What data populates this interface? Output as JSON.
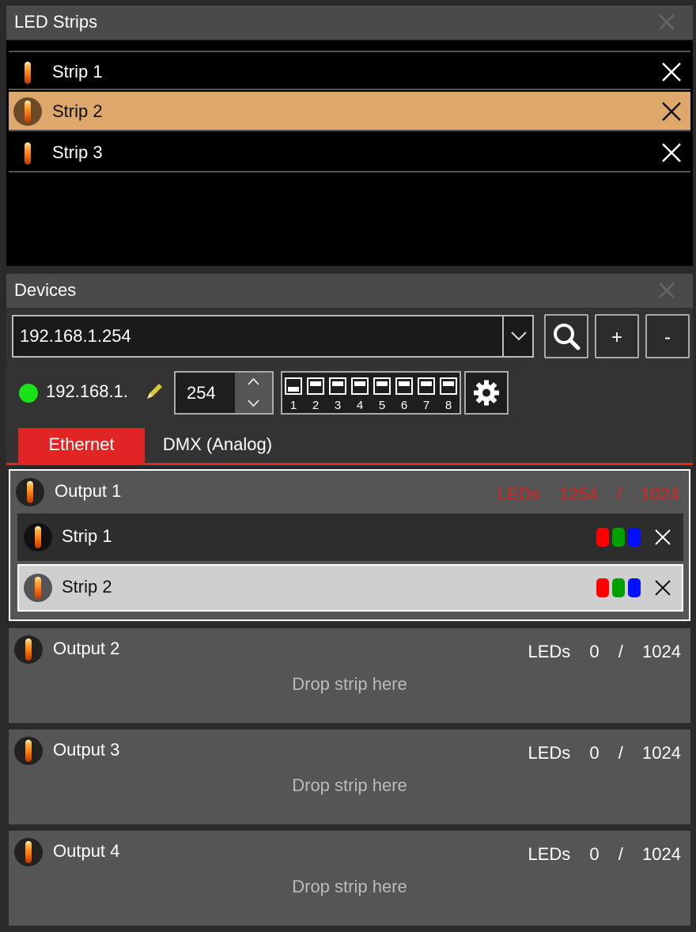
{
  "led_strips_panel": {
    "title": "LED Strips",
    "strips": [
      {
        "label": "Strip 1",
        "selected": false
      },
      {
        "label": "Strip 2",
        "selected": true
      },
      {
        "label": "Strip 3",
        "selected": false
      }
    ]
  },
  "devices_panel": {
    "title": "Devices",
    "ip_combo_value": "192.168.1.254",
    "add_label": "+",
    "remove_label": "-",
    "status_color": "#18e218",
    "ip_prefix": "192.168.1.",
    "last_octet": "254",
    "dip_switches": [
      "1",
      "2",
      "3",
      "4",
      "5",
      "6",
      "7",
      "8"
    ],
    "tabs": [
      {
        "label": "Ethernet",
        "active": true
      },
      {
        "label": "DMX (Analog)",
        "active": false
      }
    ],
    "outputs": [
      {
        "title": "Output 1",
        "leds_label": "LEDs",
        "leds_used": "1254",
        "separator": "/",
        "leds_max": "1024",
        "over_limit": true,
        "strips": [
          {
            "label": "Strip 1",
            "channels": [
              "#ff0000",
              "#00a000",
              "#0010ff"
            ]
          },
          {
            "label": "Strip 2",
            "channels": [
              "#ff0000",
              "#00a000",
              "#0010ff"
            ]
          }
        ]
      },
      {
        "title": "Output 2",
        "leds_label": "LEDs",
        "leds_used": "0",
        "separator": "/",
        "leds_max": "1024",
        "drop_text": "Drop strip here"
      },
      {
        "title": "Output 3",
        "leds_label": "LEDs",
        "leds_used": "0",
        "separator": "/",
        "leds_max": "1024",
        "drop_text": "Drop strip here"
      },
      {
        "title": "Output 4",
        "leds_label": "LEDs",
        "leds_used": "0",
        "separator": "/",
        "leds_max": "1024",
        "drop_text": "Drop strip here"
      }
    ]
  },
  "colors": {
    "accent_red": "#e12424",
    "selection_orange": "#dea76b",
    "status_green": "#18e218"
  }
}
